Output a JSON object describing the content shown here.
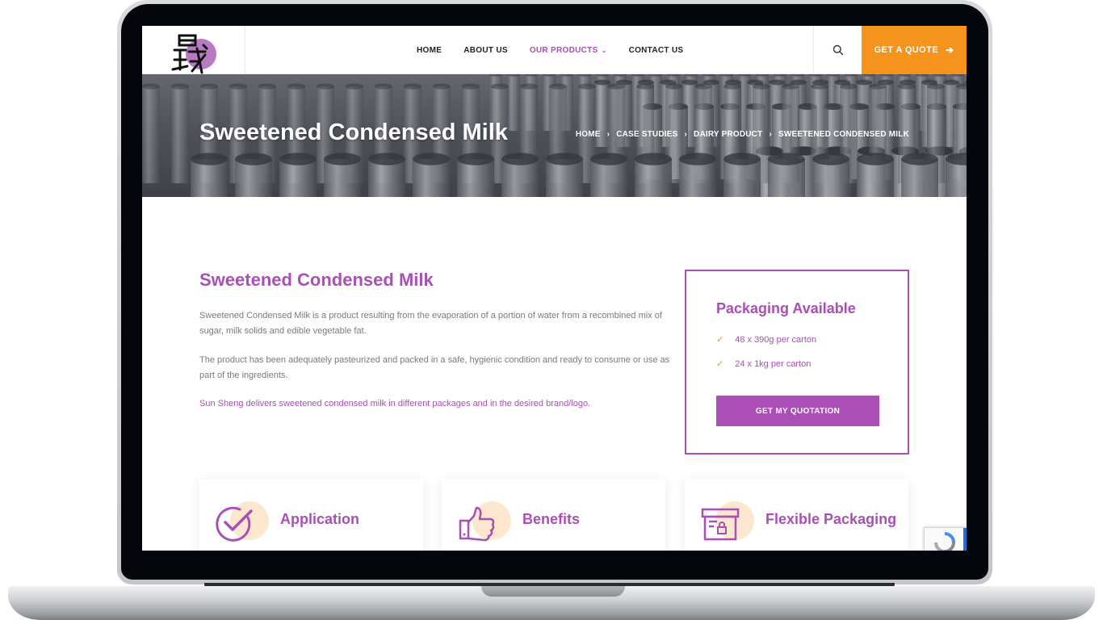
{
  "header": {
    "nav": [
      {
        "label": "HOME"
      },
      {
        "label": "ABOUT US"
      },
      {
        "label": "OUR PRODUCTS",
        "has_dropdown": true,
        "active": true
      },
      {
        "label": "CONTACT US"
      }
    ],
    "quote_button": "GET A QUOTE",
    "search_icon": "search-icon"
  },
  "hero": {
    "title": "Sweetened Condensed Milk",
    "breadcrumbs": [
      "HOME",
      "CASE STUDIES",
      "DAIRY PRODUCT",
      "SWEETENED CONDENSED MILK"
    ]
  },
  "content": {
    "title": "Sweetened Condensed Milk",
    "paragraphs": [
      "Sweetened Condensed Milk is a product resulting from the evaporation of a portion of water from a recombined mix of sugar, milk solids and edible vegetable fat.",
      "The product has been adequately pasteurized and packed in a safe, hygienic condition and ready to consume or use as part of the ingredients.",
      "Sun Sheng delivers sweetened condensed milk in different packages and in the desired brand/logo."
    ]
  },
  "packaging": {
    "title": "Packaging Available",
    "items": [
      "48 x 390g per carton",
      "24 x 1kg per carton"
    ],
    "button": "GET MY QUOTATION"
  },
  "cards": [
    {
      "title": "Application",
      "icon": "checkmark-circle-icon"
    },
    {
      "title": "Benefits",
      "icon": "thumbs-up-icon"
    },
    {
      "title": "Flexible Packaging",
      "icon": "package-box-icon"
    }
  ],
  "colors": {
    "brand_purple": "#a94fb5",
    "accent_orange": "#f5941d"
  }
}
